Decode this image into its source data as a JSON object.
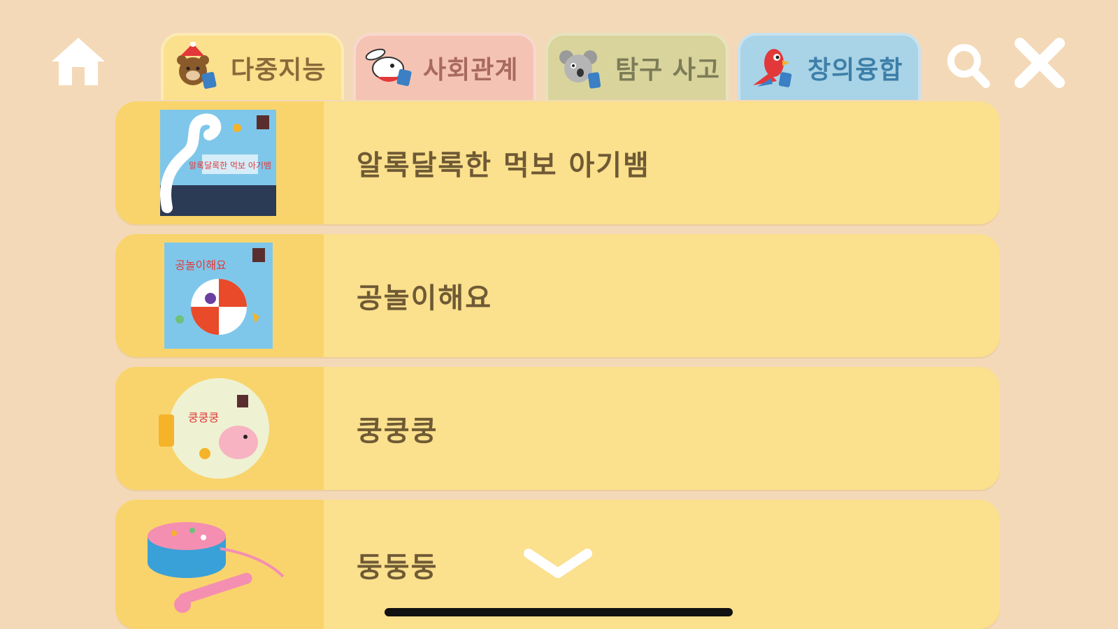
{
  "topbar": {
    "home_icon": "home-icon",
    "search_icon": "search-icon",
    "close_icon": "close-icon"
  },
  "tabs": [
    {
      "label": "다중지능",
      "mascot": "bear-mascot-icon",
      "color": "#fbe08d"
    },
    {
      "label": "사회관계",
      "mascot": "rabbit-mascot-icon",
      "color": "#f5c3b4"
    },
    {
      "label": "탐구 사고",
      "mascot": "koala-mascot-icon",
      "color": "#d9d49c"
    },
    {
      "label": "창의융합",
      "mascot": "parrot-mascot-icon",
      "color": "#a9d3e6"
    }
  ],
  "books": [
    {
      "title": "알록달록한 먹보 아기뱀",
      "cover_text": "알록달록한 먹보 아기뱀"
    },
    {
      "title": "공놀이해요",
      "cover_text": "공놀이해요"
    },
    {
      "title": "쿵쿵쿵",
      "cover_text": "쿵쿵쿵"
    },
    {
      "title": "둥둥둥",
      "cover_text": ""
    }
  ],
  "scroll_icon": "chevron-down-icon",
  "colors": {
    "background": "#f3d9b7",
    "row": "#fbe08d",
    "row_thumb": "#f9d46c",
    "title_text": "#6f5a35"
  }
}
